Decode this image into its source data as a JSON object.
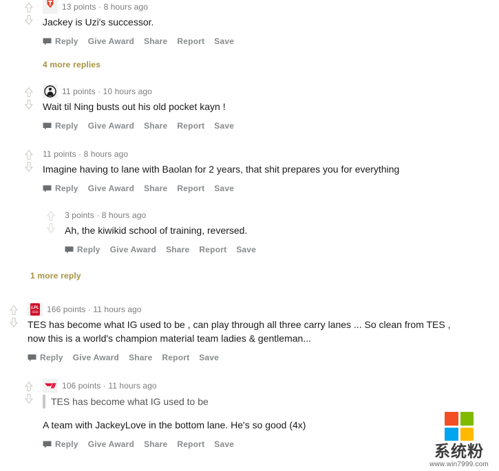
{
  "theme": {
    "text_color": "#1a1a1b",
    "meta_color": "#7c7c7c",
    "action_color": "#878a8c",
    "more_replies_color": "#a5913f",
    "thread_line_color": "#d8d8d8",
    "quote_border_color": "#c8c8c8",
    "background": "#ffffff",
    "avatar_red": "#d93a2b"
  },
  "actions": {
    "reply": "Reply",
    "give_award": "Give Award",
    "share": "Share",
    "report": "Report",
    "save": "Save"
  },
  "comments": [
    {
      "id": "c1",
      "avatar": "team-logo-red-shield-icon",
      "points": "13 points",
      "separator": "·",
      "time": "8 hours ago",
      "meta": "13 points · 8 hours ago",
      "text": "Jackey is Uzi's successor.",
      "more_replies": "4 more replies"
    },
    {
      "id": "c2",
      "avatar": "default-user-circle-icon",
      "points": "11 points",
      "separator": "·",
      "time": "10 hours ago",
      "meta": "11 points · 10 hours ago",
      "text": "Wait til Ning busts out his old pocket kayn !"
    },
    {
      "id": "c3",
      "avatar": "none",
      "points": "11 points",
      "separator": "·",
      "time": "8 hours ago",
      "meta": "11 points · 8 hours ago",
      "text": "Imagine having to lane with Baolan for 2 years, that shit prepares you for everything"
    },
    {
      "id": "c4",
      "avatar": "none",
      "points": "3 points",
      "separator": "·",
      "time": "8 hours ago",
      "meta": "3 points · 8 hours ago",
      "text": "Ah, the kiwikid school of training, reversed.",
      "more_replies": "1 more reply"
    },
    {
      "id": "c5",
      "avatar": "lpl-badge-icon",
      "points": "166 points",
      "separator": "·",
      "time": "11 hours ago",
      "meta": "166 points · 11 hours ago",
      "text": "TES has become what IG used to be , can play through all three carry lanes ... So clean from TES , now this is a world's champion material team ladies & gentleman..."
    },
    {
      "id": "c6",
      "avatar": "t1-logo-icon",
      "points": "106 points",
      "separator": "·",
      "time": "11 hours ago",
      "meta": "106 points · 11 hours ago",
      "quote": "TES has become what IG used to be",
      "text": "A team with JackeyLove in the bottom lane. He's so good (4x)"
    }
  ],
  "watermark": {
    "title_cn": "系统粉",
    "url": "www.win7999.com",
    "squares": [
      "#f25022",
      "#7fba00",
      "#00a4ef",
      "#ffb900"
    ]
  }
}
